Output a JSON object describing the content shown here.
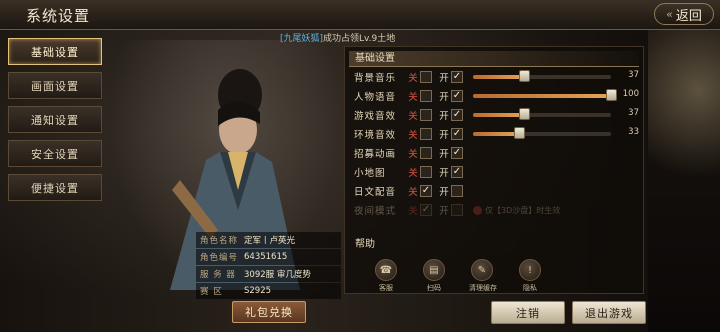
{
  "window": {
    "title": "系统设置",
    "back_label": "返回"
  },
  "notice": {
    "tag": "[九尾妖狐]",
    "text": "成功占领Lv.9土地"
  },
  "sidebar": {
    "items": [
      {
        "label": "基础设置",
        "active": true
      },
      {
        "label": "画面设置",
        "active": false
      },
      {
        "label": "通知设置",
        "active": false
      },
      {
        "label": "安全设置",
        "active": false
      },
      {
        "label": "便捷设置",
        "active": false
      }
    ]
  },
  "character": {
    "rows": [
      {
        "key": "角色名称",
        "value": "定军丨卢英光"
      },
      {
        "key": "角色编号",
        "value": "64351615"
      },
      {
        "key": "服 务 器",
        "value": "3092服 审几度势"
      },
      {
        "key": "赛    区",
        "value": "S2925"
      }
    ],
    "gift_button": "礼包兑换"
  },
  "settings": {
    "section_title": "基础设置",
    "off_label": "关",
    "on_label": "开",
    "rows": [
      {
        "label": "背景音乐",
        "on": true,
        "slider": 37,
        "value": "37"
      },
      {
        "label": "人物语音",
        "on": true,
        "slider": 100,
        "value": "100"
      },
      {
        "label": "游戏音效",
        "on": true,
        "slider": 37,
        "value": "37"
      },
      {
        "label": "环境音效",
        "on": true,
        "slider": 33,
        "value": "33"
      },
      {
        "label": "招募动画",
        "on": true
      },
      {
        "label": "小地图",
        "on": true
      },
      {
        "label": "日文配音",
        "on": false
      },
      {
        "label": "夜间模式",
        "on": false,
        "dim": true,
        "note": "仅【3D沙盘】时生效"
      }
    ]
  },
  "help": {
    "section_title": "帮助",
    "items": [
      {
        "label": "客服",
        "icon": "customer-service-icon",
        "glyph": "☎"
      },
      {
        "label": "扫码",
        "icon": "scan-icon",
        "glyph": "▤"
      },
      {
        "label": "清理缓存",
        "icon": "broom-icon",
        "glyph": "✎"
      },
      {
        "label": "隐私",
        "icon": "privacy-icon",
        "glyph": "!"
      }
    ]
  },
  "footer": {
    "logout_label": "注销",
    "quit_label": "退出游戏"
  }
}
